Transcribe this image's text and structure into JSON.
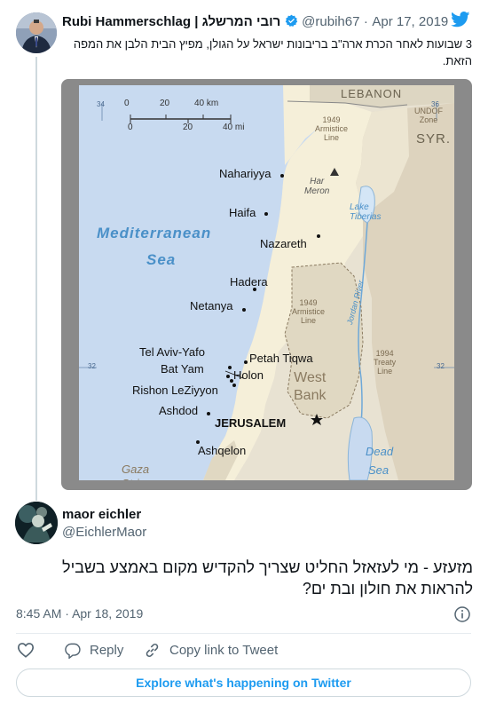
{
  "quoted": {
    "name": "Rubi Hammerschlag | רובי המרשלג",
    "handle": "@rubih67",
    "sep": "·",
    "date": "Apr 17, 2019",
    "text": "3 שבועות לאחר הכרת ארה\"ב בריבונות ישראל על הגולן, מפיץ הבית הלבן את המפה הזאת."
  },
  "map": {
    "regions": {
      "lebanon": "LEBANON",
      "syr": "SYR.",
      "westbank": "West\nBank",
      "gaza": "Gaza\nStrip"
    },
    "lines": {
      "armistice_1949_north": "1949\nArmistice\nLine",
      "undof": "UNDOF\nZone",
      "armistice_1949_west": "1949\nArmistice\nLine",
      "treaty_1994": "1994\nTreaty\nLine"
    },
    "seas": {
      "med1": "Mediterranean",
      "med2": "Sea",
      "dead1": "Dead",
      "dead2": "Sea"
    },
    "lake": "Lake\nTiberias",
    "mount": "Har\nMeron",
    "river": "Jordan River",
    "scale": {
      "km": [
        "0",
        "20",
        "40 km"
      ],
      "mi": [
        "0",
        "20",
        "40 mi"
      ]
    },
    "grid": {
      "lon34": "34",
      "lon36": "36",
      "lat32_left": "32",
      "lat32_right": "32"
    },
    "cities": [
      "Nahariyya",
      "Haifa",
      "Nazareth",
      "Hadera",
      "Netanya",
      "Tel Aviv-Yafo",
      "Bat Yam",
      "Holon",
      "Petah Tiqwa",
      "Rishon LeZiyyon",
      "Ashdod",
      "JERUSALEM",
      "Ashqelon"
    ]
  },
  "reply": {
    "name": "maor eichler",
    "handle": "@EichlerMaor",
    "text": "מזעזע - מי לעזאזל החליט שצריך להקדיש מקום באמצע בשביל להראות את חולון ובת ים?",
    "time": "8:45 AM",
    "sep": "·",
    "date": "Apr 18, 2019"
  },
  "actions": {
    "reply": "Reply",
    "copy": "Copy link to Tweet"
  },
  "explore": "Explore what's happening on Twitter",
  "colors": {
    "twitter_blue": "#1d9bf0",
    "verified": "#1d9bf0"
  }
}
